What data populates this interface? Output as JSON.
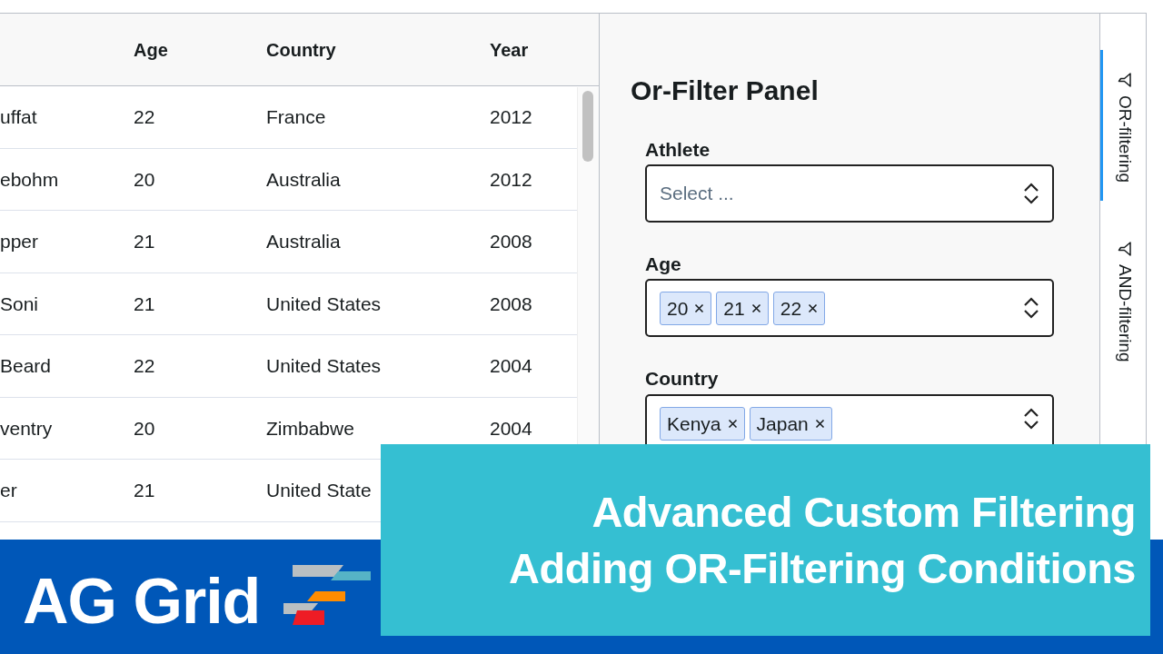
{
  "grid": {
    "columns": [
      {
        "label": "Age"
      },
      {
        "label": "Country"
      },
      {
        "label": "Year"
      }
    ],
    "rows": [
      {
        "athlete": "uffat",
        "cells": [
          "22",
          "France",
          "2012"
        ]
      },
      {
        "athlete": "ebohm",
        "cells": [
          "20",
          "Australia",
          "2012"
        ]
      },
      {
        "athlete": "pper",
        "cells": [
          "21",
          "Australia",
          "2008"
        ]
      },
      {
        "athlete": "Soni",
        "cells": [
          "21",
          "United States",
          "2008"
        ]
      },
      {
        "athlete": "Beard",
        "cells": [
          "22",
          "United States",
          "2004"
        ]
      },
      {
        "athlete": "ventry",
        "cells": [
          "20",
          "Zimbabwe",
          "2004"
        ]
      },
      {
        "athlete": "er",
        "cells": [
          "21",
          "United State"
        ]
      }
    ]
  },
  "panel": {
    "title": "Or-Filter Panel",
    "fields": [
      {
        "label": "Athlete",
        "placeholder": "Select ..."
      },
      {
        "label": "Age",
        "tags": [
          "20",
          "21",
          "22"
        ]
      },
      {
        "label": "Country",
        "tags": [
          "Kenya",
          "Japan"
        ]
      }
    ]
  },
  "side_tabs": [
    {
      "label": "OR-filtering",
      "selected": true
    },
    {
      "label": "AND-filtering",
      "selected": false
    }
  ],
  "banner": {
    "lines": [
      "Advanced Custom Filtering",
      "Adding OR-Filtering Conditions"
    ]
  },
  "logo": {
    "text": "AG Grid"
  }
}
